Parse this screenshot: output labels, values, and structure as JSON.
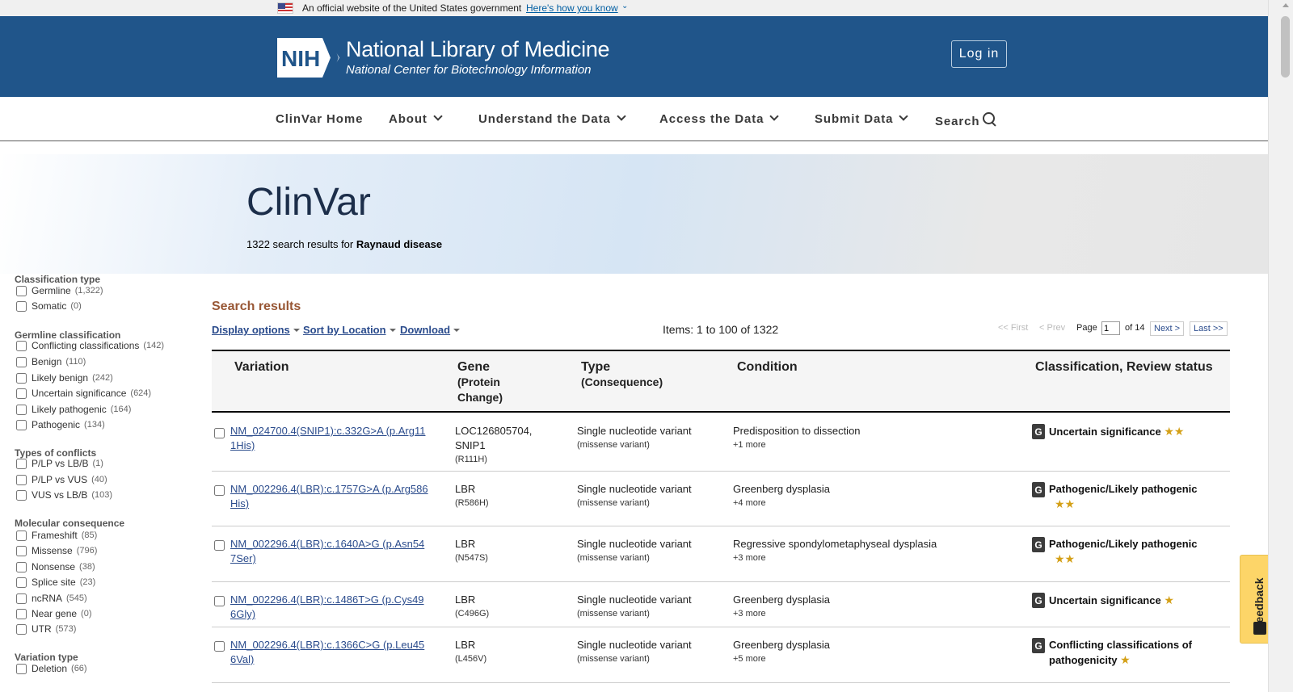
{
  "gov_banner": {
    "text": "An official website of the United States government",
    "link": "Here's how you know"
  },
  "header": {
    "org_logo": "NIH",
    "title": "National Library of Medicine",
    "subtitle": "National Center for Biotechnology Information",
    "login": "Log in"
  },
  "nav": {
    "items": [
      {
        "label": "ClinVar Home",
        "dropdown": false
      },
      {
        "label": "About",
        "dropdown": true
      },
      {
        "label": "Understand the Data",
        "dropdown": true
      },
      {
        "label": "Access the Data",
        "dropdown": true
      },
      {
        "label": "Submit Data",
        "dropdown": true
      },
      {
        "label": "Search",
        "dropdown": false,
        "icon": "search-icon"
      }
    ]
  },
  "hero": {
    "title": "ClinVar",
    "count_prefix": "1322 search results for",
    "query": "Raynaud disease"
  },
  "sidebar": {
    "facets": [
      {
        "title": "Classification type",
        "options": [
          {
            "label": "Germline",
            "count": "(1,322)"
          },
          {
            "label": "Somatic",
            "count": "(0)"
          }
        ]
      },
      {
        "title": "Germline classification",
        "options": [
          {
            "label": "Conflicting classifications",
            "count": "(142)"
          },
          {
            "label": "Benign",
            "count": "(110)"
          },
          {
            "label": "Likely benign",
            "count": "(242)"
          },
          {
            "label": "Uncertain significance",
            "count": "(624)"
          },
          {
            "label": "Likely pathogenic",
            "count": "(164)"
          },
          {
            "label": "Pathogenic",
            "count": "(134)"
          }
        ]
      },
      {
        "title": "Types of conflicts",
        "options": [
          {
            "label": "P/LP vs LB/B",
            "count": "(1)"
          },
          {
            "label": "P/LP vs VUS",
            "count": "(40)"
          },
          {
            "label": "VUS vs LB/B",
            "count": "(103)"
          }
        ]
      },
      {
        "title": "Molecular consequence",
        "options": [
          {
            "label": "Frameshift",
            "count": "(85)"
          },
          {
            "label": "Missense",
            "count": "(796)"
          },
          {
            "label": "Nonsense",
            "count": "(38)"
          },
          {
            "label": "Splice site",
            "count": "(23)"
          },
          {
            "label": "ncRNA",
            "count": "(545)"
          },
          {
            "label": "Near gene",
            "count": "(0)"
          },
          {
            "label": "UTR",
            "count": "(573)"
          }
        ]
      },
      {
        "title": "Variation type",
        "options": [
          {
            "label": "Deletion",
            "count": "(66)"
          }
        ]
      }
    ]
  },
  "results": {
    "title": "Search results",
    "display_options": "Display options",
    "sort": "Sort by Location",
    "download": "Download",
    "items_info": "Items: 1 to 100 of 1322",
    "pager": {
      "first": "<< First",
      "prev": "< Prev",
      "page_label": "Page",
      "page_value": "1",
      "of_label": "of 14",
      "next": "Next >",
      "last": "Last >>"
    },
    "columns": {
      "variation": "Variation",
      "gene": "Gene",
      "gene_sub1": "(Protein",
      "gene_sub2": "Change)",
      "type": "Type",
      "type_sub": "(Consequence)",
      "condition": "Condition",
      "classification": "Classification, Review status"
    },
    "rows": [
      {
        "variation_l1": "NM_024700.4(SNIP1):c.332G>A (p.Arg11",
        "variation_l2": "1His)",
        "gene_l1": "LOC126805704,",
        "gene_l2": "SNIP1",
        "protein": "(R111H)",
        "type": "Single nucleotide variant",
        "consequence": "(missense variant)",
        "condition": "Predisposition to dissection",
        "more": "+1 more",
        "badge": "G",
        "classification": "Uncertain significance",
        "stars": "★★"
      },
      {
        "variation_l1": "NM_002296.4(LBR):c.1757G>A (p.Arg586",
        "variation_l2": "His)",
        "gene_l1": "LBR",
        "gene_l2": "",
        "protein": "(R586H)",
        "type": "Single nucleotide variant",
        "consequence": "(missense variant)",
        "condition": "Greenberg dysplasia",
        "more": "+4 more",
        "badge": "G",
        "classification": "Pathogenic/Likely pathogenic",
        "stars": "★★"
      },
      {
        "variation_l1": "NM_002296.4(LBR):c.1640A>G (p.Asn54",
        "variation_l2": "7Ser)",
        "gene_l1": "LBR",
        "gene_l2": "",
        "protein": "(N547S)",
        "type": "Single nucleotide variant",
        "consequence": "(missense variant)",
        "condition": "Regressive spondylometaphyseal dysplasia",
        "more": "+3 more",
        "badge": "G",
        "classification": "Pathogenic/Likely pathogenic",
        "stars": "★★"
      },
      {
        "variation_l1": "NM_002296.4(LBR):c.1486T>G (p.Cys49",
        "variation_l2": "6Gly)",
        "gene_l1": "LBR",
        "gene_l2": "",
        "protein": "(C496G)",
        "type": "Single nucleotide variant",
        "consequence": "(missense variant)",
        "condition": "Greenberg dysplasia",
        "more": "+3 more",
        "badge": "G",
        "classification": "Uncertain significance",
        "stars": "★"
      },
      {
        "variation_l1": "NM_002296.4(LBR):c.1366C>G (p.Leu45",
        "variation_l2": "6Val)",
        "gene_l1": "LBR",
        "gene_l2": "",
        "protein": "(L456V)",
        "type": "Single nucleotide variant",
        "consequence": "(missense variant)",
        "condition": "Greenberg dysplasia",
        "more": "+5 more",
        "badge": "G",
        "classification": "Conflicting classifications of pathogenicity",
        "stars": "★"
      }
    ]
  },
  "feedback": {
    "label": "Feedback"
  },
  "colors": {
    "header_bg": "#20558a",
    "results_title": "#985735",
    "link": "#2a4b8c",
    "star": "#d4a017",
    "feedback_bg": "#fdd568"
  }
}
